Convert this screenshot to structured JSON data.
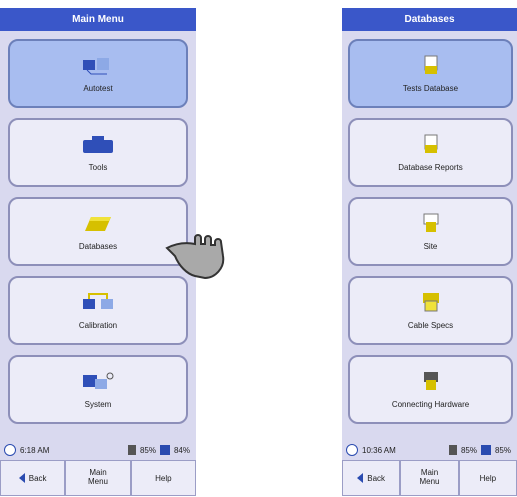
{
  "left": {
    "title": "Main Menu",
    "buttons": [
      {
        "label": "Autotest",
        "icon": "autotest-icon",
        "selected": true
      },
      {
        "label": "Tools",
        "icon": "toolbox-icon",
        "selected": false
      },
      {
        "label": "Databases",
        "icon": "database-icon",
        "selected": false
      },
      {
        "label": "Calibration",
        "icon": "calibration-icon",
        "selected": false
      },
      {
        "label": "System",
        "icon": "system-icon",
        "selected": false
      }
    ],
    "status": {
      "time": "6:18 AM",
      "battery": "85%",
      "memory": "84%"
    },
    "bottom": {
      "back": "Back",
      "main_menu": "Main\nMenu",
      "help": "Help"
    }
  },
  "right": {
    "title": "Databases",
    "buttons": [
      {
        "label": "Tests Database",
        "icon": "tests-database-icon",
        "selected": true
      },
      {
        "label": "Database Reports",
        "icon": "database-reports-icon",
        "selected": false
      },
      {
        "label": "Site",
        "icon": "site-icon",
        "selected": false
      },
      {
        "label": "Cable Specs",
        "icon": "cable-specs-icon",
        "selected": false
      },
      {
        "label": "Connecting Hardware",
        "icon": "connecting-hardware-icon",
        "selected": false
      }
    ],
    "status": {
      "time": "10:36 AM",
      "battery": "85%",
      "memory": "85%"
    },
    "bottom": {
      "back": "Back",
      "main_menu": "Main\nMenu",
      "help": "Help"
    }
  }
}
